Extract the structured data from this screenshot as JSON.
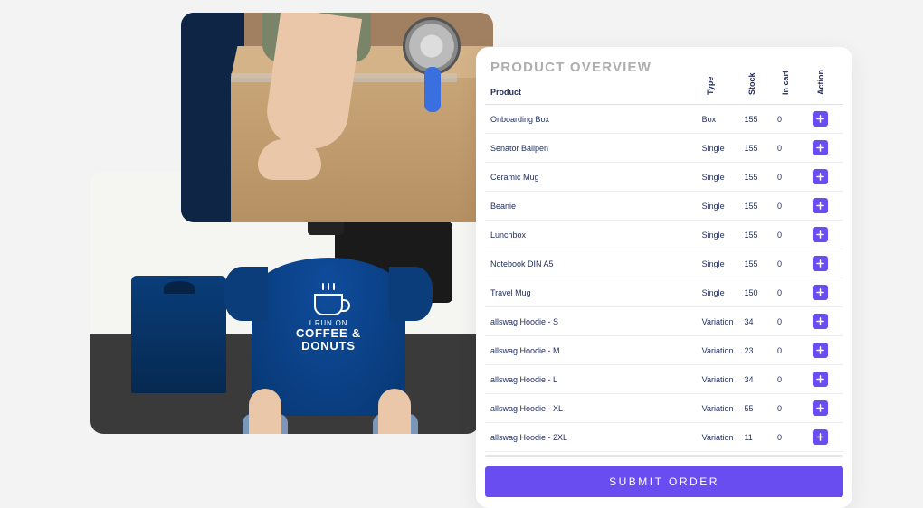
{
  "shirt_print": {
    "line1": "I RUN ON",
    "line2a": "COFFEE &",
    "line2b": "DONUTS"
  },
  "card": {
    "title": "PRODUCT OVERVIEW",
    "submit_label": "SUBMIT ORDER",
    "headers": {
      "product": "Product",
      "type": "Type",
      "stock": "Stock",
      "in_cart": "In cart",
      "action": "Action"
    },
    "rows": [
      {
        "product": "Onboarding Box",
        "type": "Box",
        "stock": 155,
        "in_cart": 0
      },
      {
        "product": "Senator Ballpen",
        "type": "Single",
        "stock": 155,
        "in_cart": 0
      },
      {
        "product": "Ceramic Mug",
        "type": "Single",
        "stock": 155,
        "in_cart": 0
      },
      {
        "product": "Beanie",
        "type": "Single",
        "stock": 155,
        "in_cart": 0
      },
      {
        "product": "Lunchbox",
        "type": "Single",
        "stock": 155,
        "in_cart": 0
      },
      {
        "product": "Notebook DIN A5",
        "type": "Single",
        "stock": 155,
        "in_cart": 0
      },
      {
        "product": "Travel Mug",
        "type": "Single",
        "stock": 150,
        "in_cart": 0
      },
      {
        "product": "allswag Hoodie - S",
        "type": "Variation",
        "stock": 34,
        "in_cart": 0
      },
      {
        "product": "allswag Hoodie - M",
        "type": "Variation",
        "stock": 23,
        "in_cart": 0
      },
      {
        "product": "allswag Hoodie - L",
        "type": "Variation",
        "stock": 34,
        "in_cart": 0
      },
      {
        "product": "allswag Hoodie - XL",
        "type": "Variation",
        "stock": 55,
        "in_cart": 0
      },
      {
        "product": "allswag Hoodie - 2XL",
        "type": "Variation",
        "stock": 11,
        "in_cart": 0
      }
    ]
  }
}
